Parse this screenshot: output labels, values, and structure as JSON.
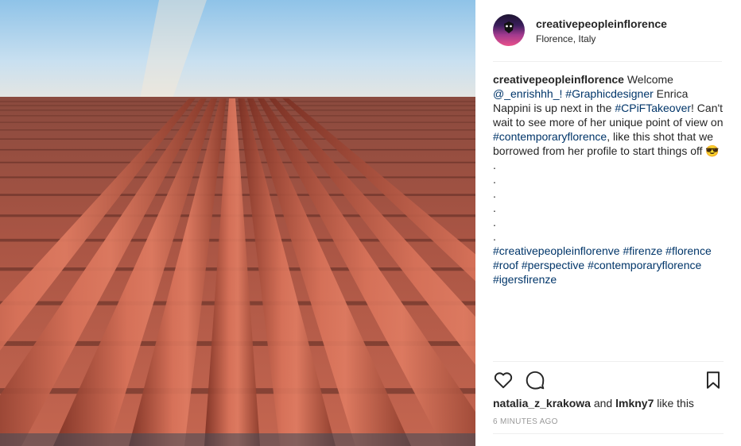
{
  "post": {
    "photo_icon": "roof-tiles-photo",
    "author": "creativepeopleinflorence",
    "location": "Florence, Italy",
    "caption": {
      "author": "creativepeopleinflorence",
      "t1": " Welcome ",
      "mention": "@_enrishhh_!",
      "t2": " ",
      "tag1": "#Graphicdesigner",
      "t3": " Enrica Nappini is up next in the ",
      "tag2": "#CPiFTakeover",
      "t4": "! Can't wait to see more of her unique point of view on ",
      "tag3": "#contemporaryflorence",
      "t5": ", like this shot that we borrowed from her profile to start things off ",
      "emoji": "😎",
      "t6": " .",
      "dots": [
        ".",
        ".",
        ".",
        ".",
        "."
      ],
      "tags_line": [
        "#creativepeopleinflorenve",
        "#firenze",
        "#florence",
        "#roof",
        "#perspective",
        "#contemporaryflorence",
        "#igersfirenze"
      ]
    },
    "likes": {
      "user1": "natalia_z_krakowa",
      "and": " and ",
      "user2": "lmkny7",
      "suffix": " like this"
    },
    "time": "6 MINUTES AGO",
    "icons": [
      "heart-icon",
      "comment-icon",
      "bookmark-icon"
    ]
  }
}
